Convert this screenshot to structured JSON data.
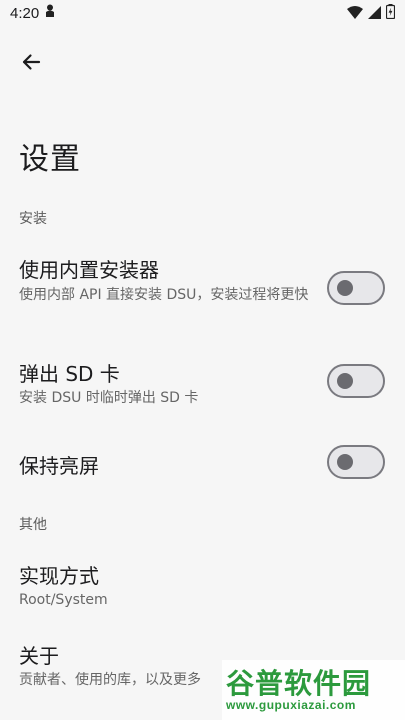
{
  "status_bar": {
    "time": "4:20",
    "icons": [
      "person-icon",
      "wifi-icon",
      "signal-icon",
      "battery-icon"
    ]
  },
  "toolbar": {
    "back_icon": "arrow-left-icon"
  },
  "page": {
    "title": "设置"
  },
  "sections": {
    "install": {
      "header": "安装",
      "builtin_installer": {
        "title": "使用内置安装器",
        "summary": "使用内部 API 直接安装 DSU，安装过程将更快",
        "enabled": false
      },
      "eject_sd": {
        "title": "弹出 SD 卡",
        "summary": "安装 DSU 时临时弹出 SD 卡",
        "enabled": false
      },
      "keep_screen_on": {
        "title": "保持亮屏",
        "enabled": false
      }
    },
    "other": {
      "header": "其他",
      "implementation": {
        "title": "实现方式",
        "summary": "Root/System"
      },
      "about": {
        "title": "关于",
        "summary": "贡献者、使用的库，以及更多"
      }
    }
  },
  "watermark": {
    "main": "谷普软件园",
    "sub": "www.gupuxiazai.com"
  },
  "colors": {
    "background": "#f6f6f6",
    "toggle_track": "#e7e7ea",
    "toggle_outline": "#7a7a80",
    "watermark_green": "#2c9a3d"
  }
}
